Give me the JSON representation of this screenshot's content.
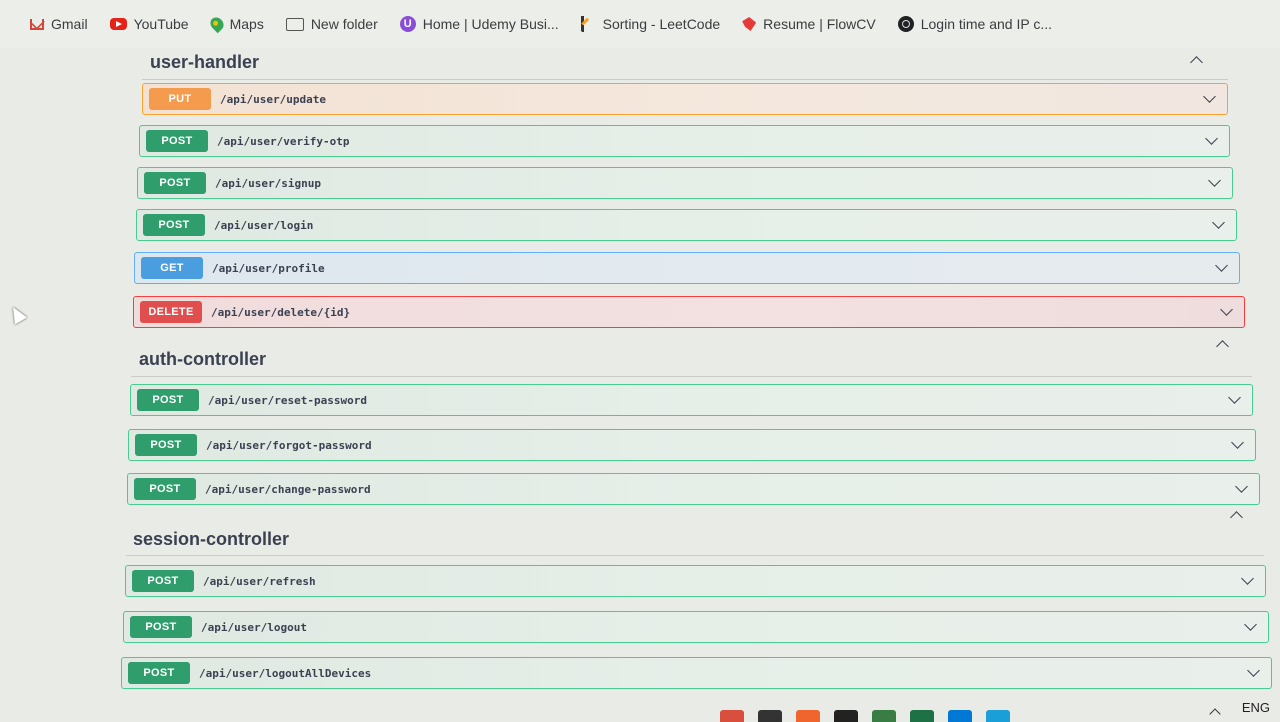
{
  "bookmarks": [
    {
      "label": "Gmail",
      "icon": "gmail-icon"
    },
    {
      "label": "YouTube",
      "icon": "youtube-icon"
    },
    {
      "label": "Maps",
      "icon": "maps-icon"
    },
    {
      "label": "New folder",
      "icon": "folder-icon"
    },
    {
      "label": "Home | Udemy Busi...",
      "icon": "udemy-icon"
    },
    {
      "label": "Sorting - LeetCode",
      "icon": "leetcode-icon"
    },
    {
      "label": "Resume | FlowCV",
      "icon": "flowcv-icon"
    },
    {
      "label": "Login time and IP c...",
      "icon": "clock-icon"
    }
  ],
  "sections": [
    {
      "title": "user-handler",
      "operations": [
        {
          "method": "PUT",
          "path": "/api/user/update"
        },
        {
          "method": "POST",
          "path": "/api/user/verify-otp"
        },
        {
          "method": "POST",
          "path": "/api/user/signup"
        },
        {
          "method": "POST",
          "path": "/api/user/login"
        },
        {
          "method": "GET",
          "path": "/api/user/profile"
        },
        {
          "method": "DELETE",
          "path": "/api/user/delete/{id}"
        }
      ]
    },
    {
      "title": "auth-controller",
      "operations": [
        {
          "method": "POST",
          "path": "/api/user/reset-password"
        },
        {
          "method": "POST",
          "path": "/api/user/forgot-password"
        },
        {
          "method": "POST",
          "path": "/api/user/change-password"
        }
      ]
    },
    {
      "title": "session-controller",
      "operations": [
        {
          "method": "POST",
          "path": "/api/user/refresh"
        },
        {
          "method": "POST",
          "path": "/api/user/logout"
        },
        {
          "method": "POST",
          "path": "/api/user/logoutAllDevices"
        }
      ]
    }
  ],
  "taskbar": {
    "language": "ENG"
  },
  "colors": {
    "post": "#49cc90",
    "put": "#fca130",
    "get": "#61affe",
    "delete": "#f93e3e"
  }
}
